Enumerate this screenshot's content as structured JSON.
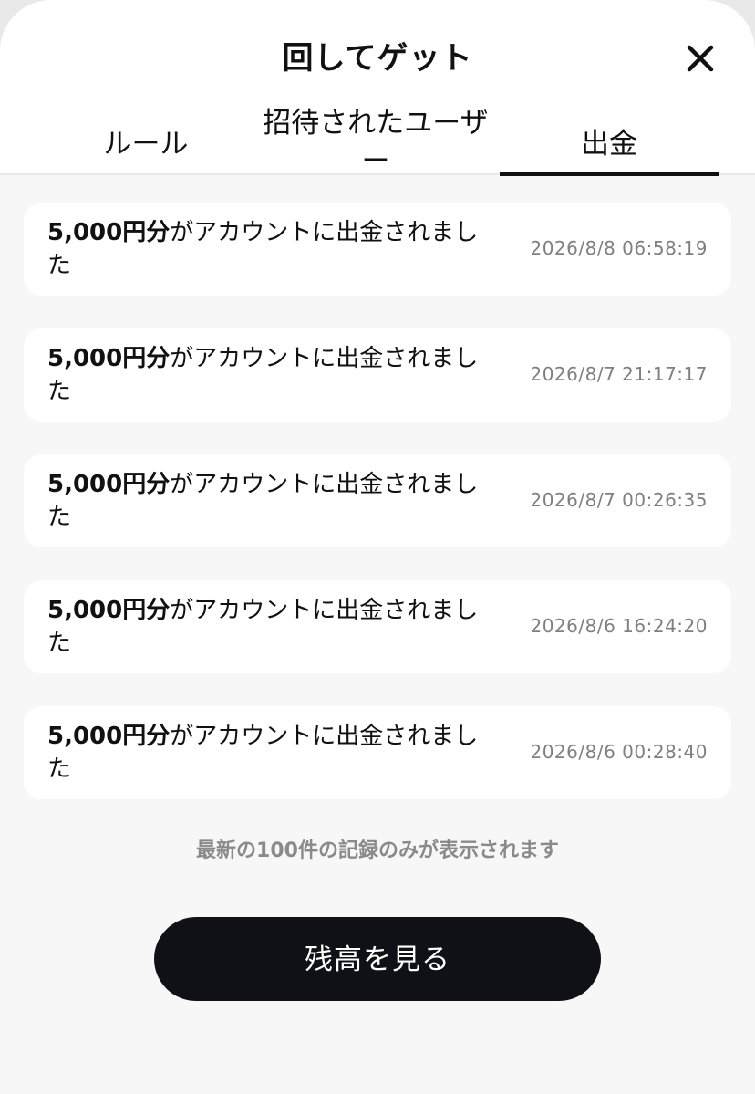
{
  "header": {
    "title": "回してゲット"
  },
  "tabs": [
    {
      "label": "ルール"
    },
    {
      "label": "招待されたユーザー"
    },
    {
      "label": "出金",
      "active": true
    }
  ],
  "records": [
    {
      "amount": "5,000円分",
      "message": "がアカウントに出金されました",
      "datetime": "2026/8/8 06:58:19"
    },
    {
      "amount": "5,000円分",
      "message": "がアカウントに出金されました",
      "datetime": "2026/8/7 21:17:17"
    },
    {
      "amount": "5,000円分",
      "message": "がアカウントに出金されました",
      "datetime": "2026/8/7 00:26:35"
    },
    {
      "amount": "5,000円分",
      "message": "がアカウントに出金されました",
      "datetime": "2026/8/6 16:24:20"
    },
    {
      "amount": "5,000円分",
      "message": "がアカウントに出金されました",
      "datetime": "2026/8/6 00:28:40"
    }
  ],
  "footer": {
    "note": "最新の100件の記録のみが表示されます",
    "button_label": "残高を見る"
  },
  "colors": {
    "button_bg": "#0f1117",
    "text_primary": "#111111",
    "text_secondary": "#7f7f7f"
  },
  "icons": {
    "close": "close-icon"
  }
}
